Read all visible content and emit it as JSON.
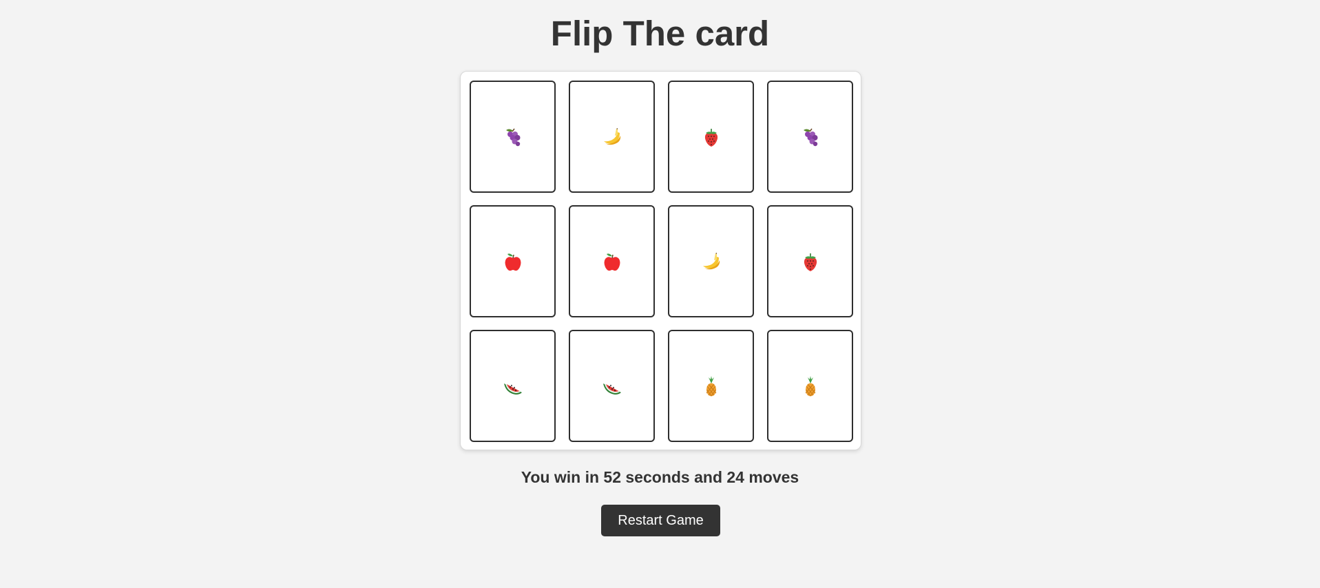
{
  "title": "Flip The card",
  "cards": [
    {
      "fruit": "grapes"
    },
    {
      "fruit": "banana"
    },
    {
      "fruit": "strawberry"
    },
    {
      "fruit": "grapes"
    },
    {
      "fruit": "apple"
    },
    {
      "fruit": "apple"
    },
    {
      "fruit": "banana"
    },
    {
      "fruit": "strawberry"
    },
    {
      "fruit": "watermelon"
    },
    {
      "fruit": "watermelon"
    },
    {
      "fruit": "pineapple"
    },
    {
      "fruit": "pineapple"
    }
  ],
  "status": "You win in 52 seconds and 24 moves",
  "restart_label": "Restart Game",
  "colors": {
    "background": "#f3f3f3",
    "text": "#333333",
    "button": "#333333",
    "card_border": "#2e2e2e"
  }
}
